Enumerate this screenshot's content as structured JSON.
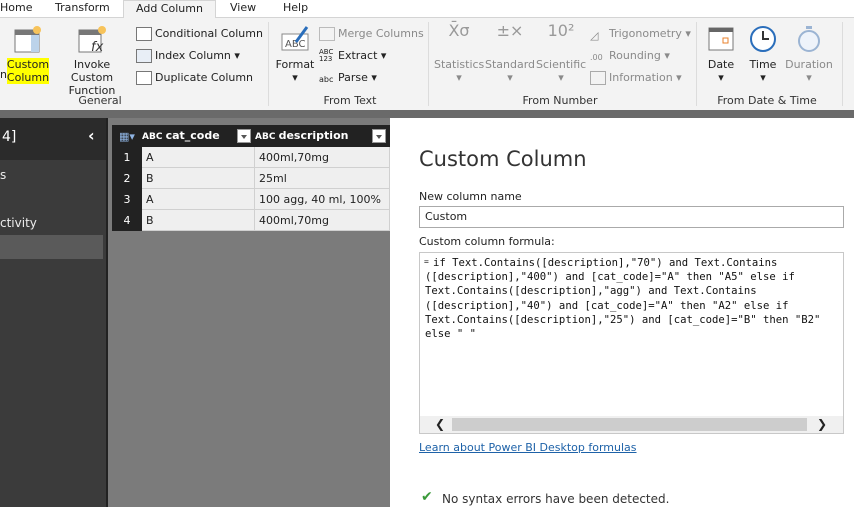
{
  "tabs": [
    "Home",
    "Transform",
    "Add Column",
    "View",
    "Help"
  ],
  "ribbon": {
    "general": {
      "label": "General",
      "custom_column": [
        "Custom",
        "Column"
      ],
      "invoke": [
        "Invoke Custom",
        "Function"
      ],
      "conditional": "Conditional Column",
      "index": "Index Column",
      "duplicate": "Duplicate Column",
      "cut_letter": "n"
    },
    "from_text": {
      "label": "From Text",
      "format": "Format",
      "merge": "Merge Columns",
      "extract": "Extract",
      "parse": "Parse"
    },
    "from_number": {
      "label": "From Number",
      "statistics": "Statistics",
      "standard": "Standard",
      "scientific": "Scientific",
      "trigonometry": "Trigonometry",
      "rounding": "Rounding",
      "information": "Information"
    },
    "from_date": {
      "label": "From Date & Time",
      "date": "Date",
      "time": "Time",
      "duration": "Duration"
    }
  },
  "left_pane": {
    "title": "4]",
    "items": [
      "s",
      "ctivity"
    ]
  },
  "table": {
    "columns": [
      "cat_code",
      "description"
    ],
    "rows": [
      [
        "1",
        "A",
        "400ml,70mg"
      ],
      [
        "2",
        "B",
        "25ml"
      ],
      [
        "3",
        "A",
        "100 agg, 40 ml, 100%"
      ],
      [
        "4",
        "B",
        "400ml,70mg"
      ]
    ]
  },
  "dialog": {
    "title": "Custom Column",
    "name_label": "New column name",
    "name_value": "Custom",
    "formula_label": "Custom column formula:",
    "formula": "if Text.Contains([description],\"70\") and Text.Contains\n([description],\"400\") and [cat_code]=\"A\" then \"A5\" else if\nText.Contains([description],\"agg\") and Text.Contains\n([description],\"40\") and [cat_code]=\"A\" then \"A2\" else if\nText.Contains([description],\"25\") and [cat_code]=\"B\" then \"B2\"\nelse \" \"",
    "learn_link": "Learn about Power BI Desktop formulas",
    "status": "No syntax errors have been detected."
  },
  "colors": {
    "accent": "#1e62a8",
    "highlight": "#ffff00",
    "success": "#3a9a3a"
  }
}
